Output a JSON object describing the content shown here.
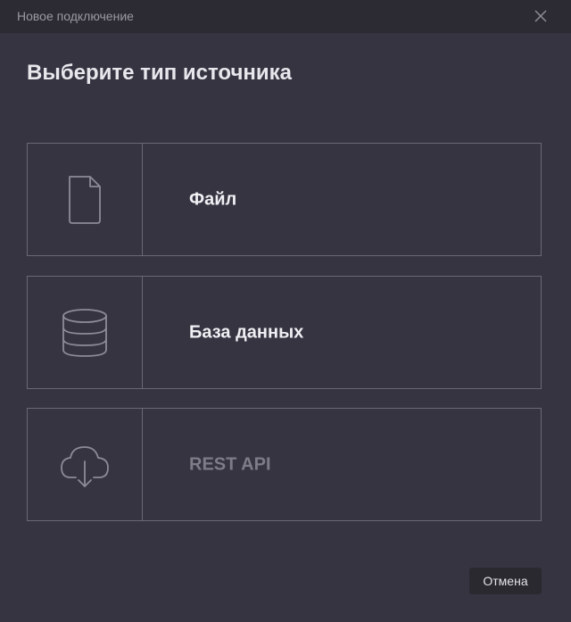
{
  "window": {
    "title": "Новое подключение",
    "close_icon": "close-icon"
  },
  "heading": "Выберите тип источника",
  "options": [
    {
      "label": "Файл",
      "icon": "file-icon",
      "enabled": true
    },
    {
      "label": "База данных",
      "icon": "database-icon",
      "enabled": true
    },
    {
      "label": "REST API",
      "icon": "cloud-download-icon",
      "enabled": false
    }
  ],
  "footer": {
    "cancel_label": "Отмена"
  },
  "colors": {
    "background": "#363441",
    "titlebar": "#2c2b33",
    "border": "#6a6873",
    "text": "#f0eff3",
    "disabled_text": "#7e7c86"
  }
}
